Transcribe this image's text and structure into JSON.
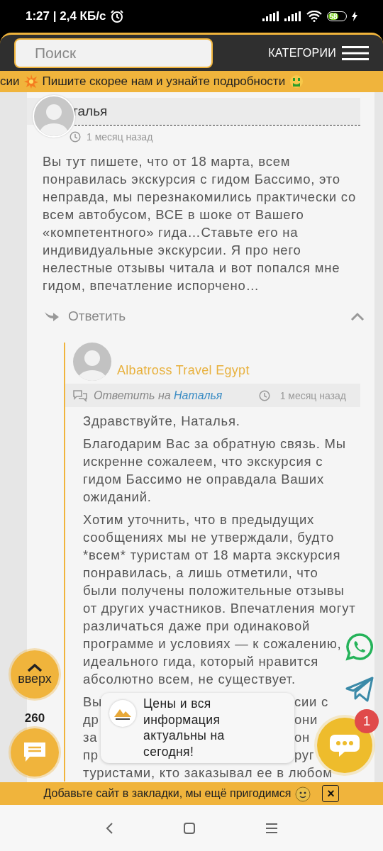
{
  "status_bar": {
    "time": "1:27 | 2,4 КБ/с",
    "battery": "58"
  },
  "header": {
    "search": {
      "placeholder": "Поиск"
    },
    "menu_label": "КАТЕГОРИИ"
  },
  "announcement": {
    "lead": "сии",
    "text": "Пишите скорее нам и узнайте подробности"
  },
  "comment": {
    "author": "талья",
    "time": "1 месяц назад",
    "text": "Вы тут пишете, что от 18 марта, всем понравилась экскурсия с гидом Бассимо, это неправда, мы перезнакомились практически со всем автобусом, ВСЕ в шоке от Вашего «компетентного» гида…Ставьте его на индивидуальные экскурсии. Я про него нелестные отзывы читала и вот попался мне гидом, впечатление испорчено…",
    "reply_label": "Ответить",
    "expanded": true
  },
  "reply": {
    "author": "Albatross Travel Egypt",
    "reply_prefix": "Ответить на",
    "reply_to": "Наталья",
    "time": "1 месяц назад",
    "paragraphs": [
      "Здравствуйте, Наталья.",
      "Благодарим Вас за обратную связь. Мы искренне сожалеем, что экскурсия с гидом Бассимо не оправдала Ваших ожиданий.",
      "Хотим уточнить, что в предыдущих сообщениях мы не утверждали, будто *всем* туристам от 18 марта экскурсия понравилась, а лишь отметили, что были получены положительные отзывы от других участников. Впечатления могут различаться даже при одинаковой программе и условиях — к сожалению, идеального гида, который нравится абсолютно всем, не существует."
    ],
    "partial_lines": [
      {
        "left": "Вы",
        "right": "сии с"
      },
      {
        "left": "др",
        "right": "они"
      },
      {
        "left": "за",
        "right": "он"
      },
      {
        "left": "пр",
        "right": "руг"
      }
    ],
    "last_line": "туристами, кто заказывал ее в любом"
  },
  "floating": {
    "up_label": "вверх",
    "comment_count": "260",
    "chat_badge": "1"
  },
  "popup": {
    "text": "Цены и вся информация актуальны на сегодня!"
  },
  "bookmark_bar": {
    "text": "Добавьте сайт в закладки, мы ещё пригодимся",
    "close": "×"
  }
}
